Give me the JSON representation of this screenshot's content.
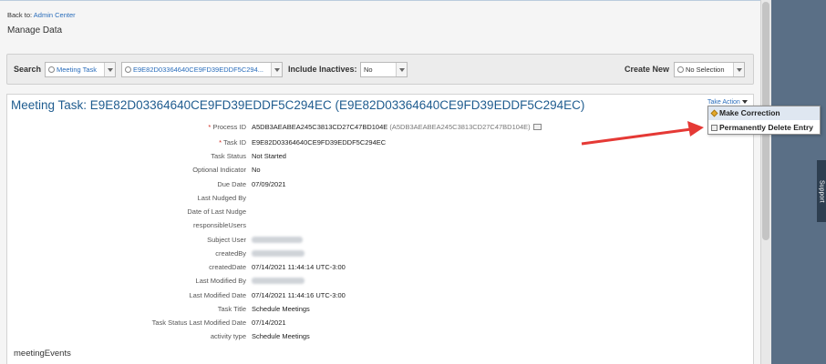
{
  "header": {
    "back_prefix": "Back to:",
    "back_link": "Admin Center",
    "page_title": "Manage Data"
  },
  "search": {
    "label": "Search",
    "type_value": "Meeting Task",
    "id_value": "E9E82D03364640CE9FD39EDDF5C294...",
    "include_inactives_label": "Include Inactives:",
    "include_inactives_value": "No",
    "create_new_label": "Create New",
    "create_new_value": "No Selection"
  },
  "record": {
    "title": "Meeting Task: E9E82D03364640CE9FD39EDDF5C294EC (E9E82D03364640CE9FD39EDDF5C294EC)",
    "take_action_label": "Take Action",
    "fields": [
      {
        "label": "Process ID",
        "required": "*",
        "value": "A5DB3AEABEA245C3813CD27C47BD104E",
        "extra": "(A5DB3AEABEA245C3813CD27C47BD104E)"
      },
      {
        "label": "Task ID",
        "required": "*",
        "value": "E9E82D03364640CE9FD39EDDF5C294EC"
      },
      {
        "label": "Task Status",
        "value": "Not Started"
      },
      {
        "label": "Optional Indicator",
        "value": "No"
      },
      {
        "label": "Due Date",
        "value": "07/09/2021"
      },
      {
        "label": "Last Nudged By",
        "value": ""
      },
      {
        "label": "Date of Last Nudge",
        "value": ""
      },
      {
        "label": "responsibleUsers",
        "value": ""
      },
      {
        "label": "Subject User",
        "value": ""
      },
      {
        "label": "createdBy",
        "value": ""
      },
      {
        "label": "createdDate",
        "value": "07/14/2021 11:44:14 UTC-3:00"
      },
      {
        "label": "Last Modified By",
        "value": ""
      },
      {
        "label": "Last Modified Date",
        "value": "07/14/2021 11:44:16 UTC-3:00"
      },
      {
        "label": "Task Title",
        "value": "Schedule Meetings"
      },
      {
        "label": "Task Status Last Modified Date",
        "value": "07/14/2021"
      },
      {
        "label": "activity type",
        "value": "Schedule Meetings"
      }
    ],
    "section_label": "meetingEvents"
  },
  "menu": {
    "make_correction": "Make Correction",
    "permanently_delete": "Permanently Delete Entry"
  },
  "sidebar": {
    "support_label": "Support"
  },
  "colors": {
    "accent": "#1f5c8f",
    "link": "#2a6dbb",
    "arrow": "#e53935",
    "required": "#d0271d"
  }
}
